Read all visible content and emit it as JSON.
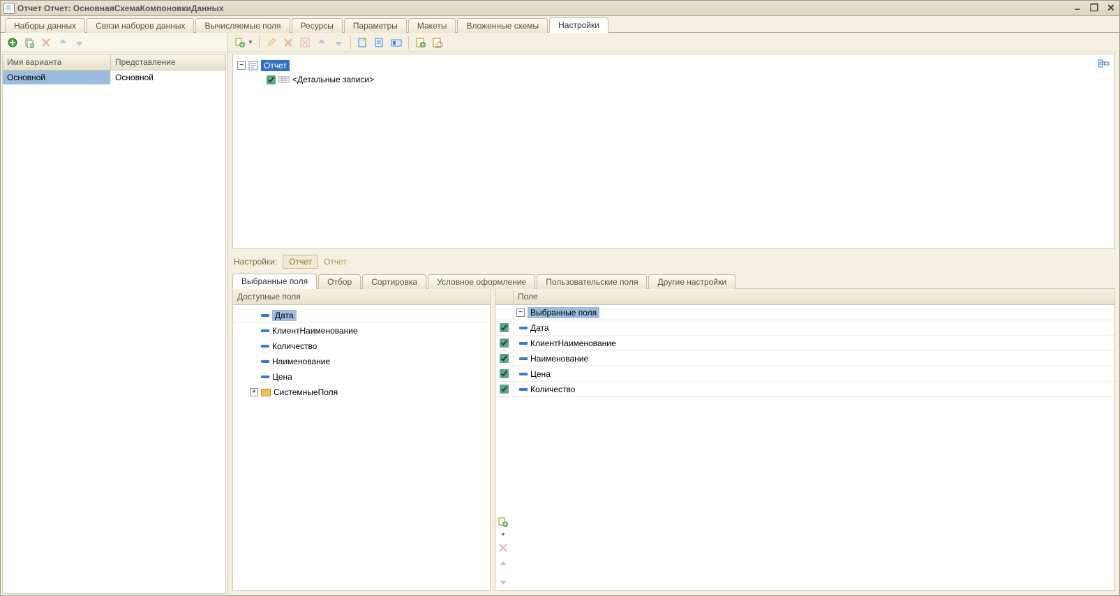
{
  "window": {
    "title": "Отчет Отчет: ОсновнаяСхемаКомпоновкиДанных"
  },
  "mainTabs": [
    {
      "label": "Наборы данных",
      "active": false
    },
    {
      "label": "Связи наборов данных",
      "active": false
    },
    {
      "label": "Вычисляемые поля",
      "active": false
    },
    {
      "label": "Ресурсы",
      "active": false
    },
    {
      "label": "Параметры",
      "active": false
    },
    {
      "label": "Макеты",
      "active": false
    },
    {
      "label": "Вложенные схемы",
      "active": false
    },
    {
      "label": "Настройки",
      "active": true
    }
  ],
  "variants": {
    "col1": "Имя варианта",
    "col2": "Представление",
    "rows": [
      {
        "name": "Основной",
        "presentation": "Основной"
      }
    ]
  },
  "reportTree": {
    "root": "Отчет",
    "child": "<Детальные записи>"
  },
  "breadcrumb": {
    "label": "Настройки:",
    "btn": "Отчет",
    "path": "Отчет"
  },
  "subTabs": [
    {
      "label": "Выбранные поля",
      "active": true
    },
    {
      "label": "Отбор",
      "active": false
    },
    {
      "label": "Сортировка",
      "active": false
    },
    {
      "label": "Условное оформление",
      "active": false
    },
    {
      "label": "Пользовательские поля",
      "active": false
    },
    {
      "label": "Другие настройки",
      "active": false
    }
  ],
  "availableFields": {
    "header": "Доступные поля",
    "items": [
      {
        "label": "Дата",
        "selected": true,
        "type": "field"
      },
      {
        "label": "КлиентНаименование",
        "selected": false,
        "type": "field"
      },
      {
        "label": "Количество",
        "selected": false,
        "type": "field"
      },
      {
        "label": "Наименование",
        "selected": false,
        "type": "field"
      },
      {
        "label": "Цена",
        "selected": false,
        "type": "field"
      },
      {
        "label": "СистемныеПоля",
        "selected": false,
        "type": "folder"
      }
    ]
  },
  "selectedFields": {
    "header": "Поле",
    "groupLabel": "Выбранные поля",
    "items": [
      {
        "label": "Дата",
        "checked": true
      },
      {
        "label": "КлиентНаименование",
        "checked": true
      },
      {
        "label": "Наименование",
        "checked": true
      },
      {
        "label": "Цена",
        "checked": true
      },
      {
        "label": "Количество",
        "checked": true
      }
    ]
  }
}
